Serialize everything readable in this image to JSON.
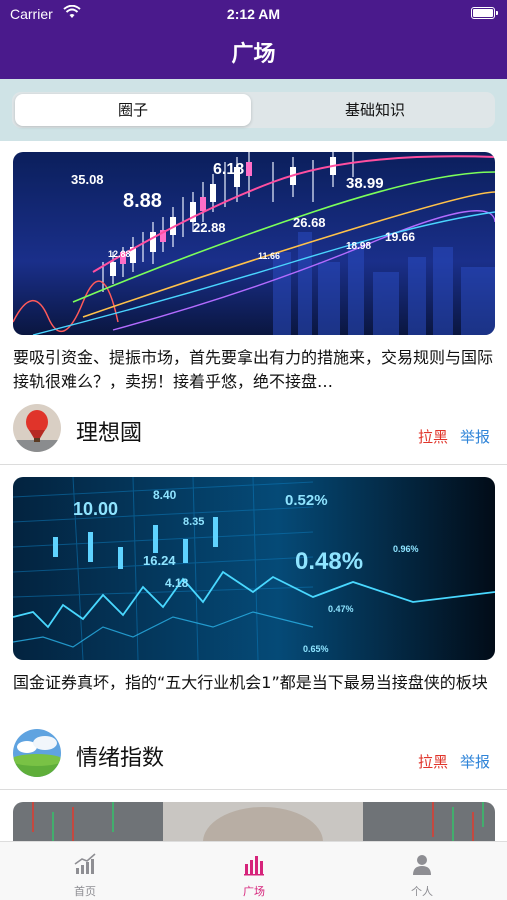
{
  "status_bar": {
    "carrier": "Carrier",
    "time": "2:12 AM"
  },
  "nav": {
    "title": "广场"
  },
  "segments": [
    {
      "label": "圈子",
      "selected": true
    },
    {
      "label": "基础知识",
      "selected": false
    }
  ],
  "posts": [
    {
      "text": "要吸引资金、提振市场，首先要拿出有力的措施来，交易规则与国际接轨很难么？，卖拐！接着乎悠，绝不接盘…",
      "author": "理想國",
      "block_label": "拉黑",
      "report_label": "举报",
      "image_labels": [
        "35.08",
        "8.88",
        "6.18",
        "38.99",
        "22.88",
        "26.68",
        "18.98",
        "19.66",
        "11.66",
        "12.88"
      ]
    },
    {
      "text": "国金证券真坏，指的“五大行业机会1”都是当下最易当接盘侠的板块",
      "author": "情绪指数",
      "block_label": "拉黑",
      "report_label": "举报",
      "image_labels": [
        "10.00",
        "8.40",
        "8.35",
        "16.24",
        "4.18",
        "0.52%",
        "0.48%",
        "0.47%",
        "0.65%",
        "0.96%"
      ]
    }
  ],
  "tabbar": [
    {
      "label": "首页",
      "icon": "trend-chart-icon",
      "active": false
    },
    {
      "label": "广场",
      "icon": "bar-chart-icon",
      "active": true
    },
    {
      "label": "个人",
      "icon": "person-icon",
      "active": false
    }
  ],
  "colors": {
    "header": "#4a1a8c",
    "block": "#e0352b",
    "report": "#2f84d8",
    "tab_active": "#d6247b"
  }
}
